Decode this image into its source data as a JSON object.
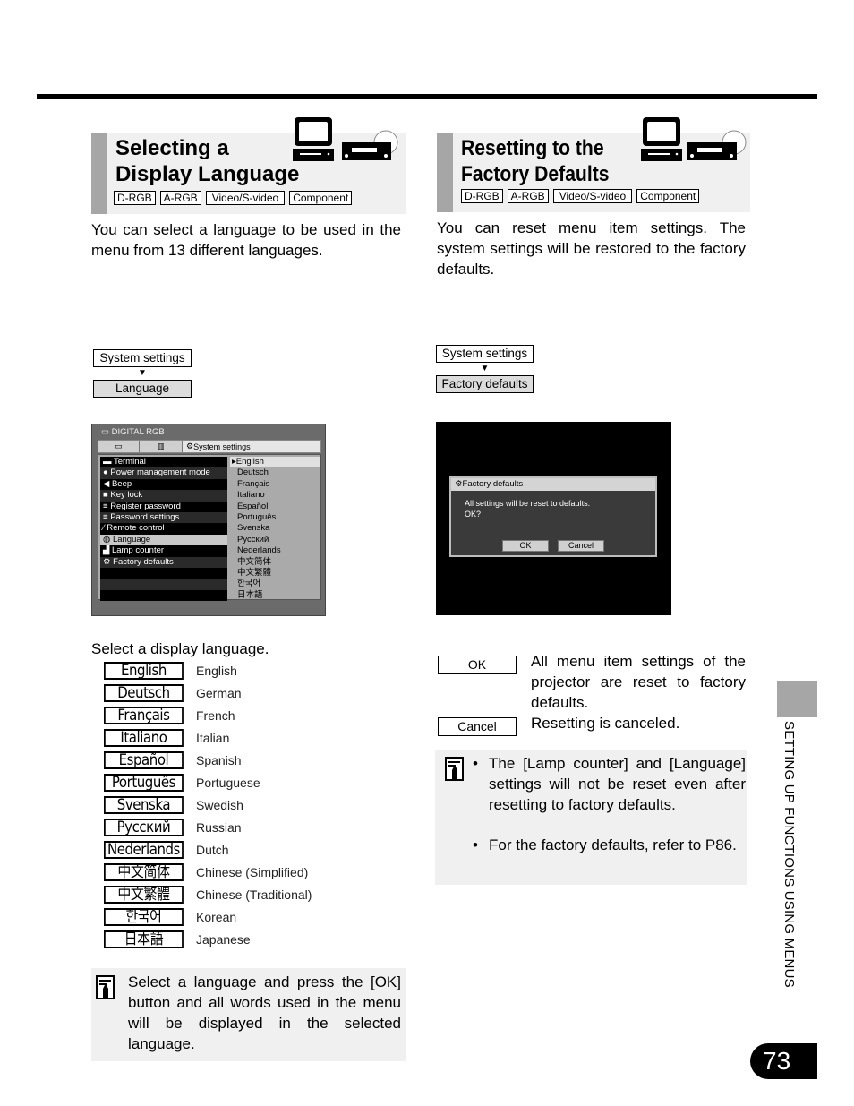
{
  "left_section": {
    "title_line1": "Selecting a",
    "title_line2": "Display Language",
    "tags": [
      "D-RGB",
      "A-RGB",
      "Video/S-video",
      "Component"
    ],
    "intro": "You can select a language to be used in the menu from 13 different languages.",
    "menu_path": {
      "step1": "System settings",
      "arrow": "▼",
      "step2": "Language"
    },
    "screen": {
      "title": "DIGITAL RGB",
      "tab_label": "System settings",
      "menu_items": [
        "Terminal",
        "Power management mode",
        "Beep",
        "Key lock",
        "Register password",
        "Password settings",
        "Remote control",
        "Language",
        "Lamp counter",
        "Factory defaults",
        "",
        ""
      ],
      "selected_item": "Language",
      "options": [
        "English",
        "Deutsch",
        "Français",
        "Italiano",
        "Español",
        "Português",
        "Svenska",
        "Русский",
        "Nederlands",
        "中文简体",
        "中文繁體",
        "한국어",
        "日本語"
      ],
      "selected_option": "English"
    },
    "instruction": "Select a display language.",
    "languages": [
      {
        "native": "English",
        "english": "English"
      },
      {
        "native": "Deutsch",
        "english": "German"
      },
      {
        "native": "Français",
        "english": "French"
      },
      {
        "native": "Italiano",
        "english": "Italian"
      },
      {
        "native": "Español",
        "english": "Spanish"
      },
      {
        "native": "Português",
        "english": "Portuguese"
      },
      {
        "native": "Svenska",
        "english": "Swedish"
      },
      {
        "native": "Русский",
        "english": "Russian"
      },
      {
        "native": "Nederlands",
        "english": "Dutch"
      },
      {
        "native": "中文简体",
        "english": "Chinese (Simplified)"
      },
      {
        "native": "中文繁體",
        "english": "Chinese (Traditional)"
      },
      {
        "native": "한국어",
        "english": "Korean"
      },
      {
        "native": "日本語",
        "english": "Japanese"
      }
    ],
    "note": "Select a language and press the [OK] button and all words used in the menu will be displayed in the selected language."
  },
  "right_section": {
    "title_line1": "Resetting to the",
    "title_line2": "Factory Defaults",
    "tags": [
      "D-RGB",
      "A-RGB",
      "Video/S-video",
      "Component"
    ],
    "intro": "You can reset menu item settings. The system settings will be restored to the factory defaults.",
    "menu_path": {
      "step1": "System settings",
      "arrow": "▼",
      "step2": "Factory defaults"
    },
    "dialog": {
      "title": "Factory defaults",
      "message_line1": "All settings will be reset to defaults.",
      "message_line2": "OK?",
      "ok_label": "OK",
      "cancel_label": "Cancel"
    },
    "buttons": [
      {
        "label": "OK",
        "description": "All menu item settings of the projector are reset to factory defaults."
      },
      {
        "label": "Cancel",
        "description": "Resetting is canceled."
      }
    ],
    "notes": [
      "The [Lamp counter] and [Language] settings will not be reset even after resetting to factory defaults.",
      "For the factory defaults, refer to P86."
    ],
    "bullet": "•"
  },
  "side_tab": "SETTING UP FUNCTIONS USING MENUS",
  "page_number": "73"
}
